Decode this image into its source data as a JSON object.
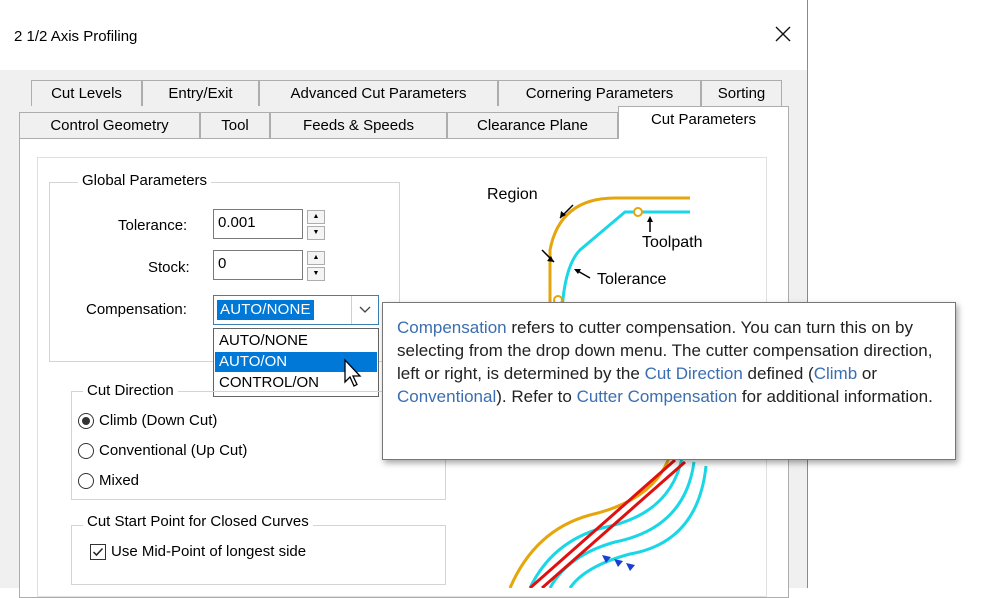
{
  "window": {
    "title": "2 1/2 Axis Profiling"
  },
  "tabs": {
    "row1": [
      "Cut Levels",
      "Entry/Exit",
      "Advanced Cut Parameters",
      "Cornering Parameters",
      "Sorting"
    ],
    "row2": [
      "Control Geometry",
      "Tool",
      "Feeds & Speeds",
      "Clearance Plane",
      "Cut Parameters"
    ],
    "active": "Cut Parameters"
  },
  "global_parameters": {
    "title": "Global Parameters",
    "tolerance_label": "Tolerance:",
    "tolerance_value": "0.001",
    "stock_label": "Stock:",
    "stock_value": "0",
    "compensation_label": "Compensation:",
    "compensation_value": "AUTO/NONE",
    "compensation_options": [
      "AUTO/NONE",
      "AUTO/ON",
      "CONTROL/ON"
    ],
    "highlighted_option": "AUTO/ON"
  },
  "cut_direction": {
    "title": "Cut Direction",
    "options": [
      "Climb (Down Cut)",
      "Conventional (Up Cut)",
      "Mixed"
    ],
    "selected": "Climb (Down Cut)"
  },
  "cut_start": {
    "title": "Cut Start Point for Closed Curves",
    "checkbox_label": "Use Mid-Point of longest side",
    "checked": true
  },
  "diagram": {
    "region_label": "Region",
    "toolpath_label": "Toolpath",
    "tolerance_label": "Tolerance",
    "region_color": "#e6a50a",
    "toolpath_color": "#19d7e6",
    "red_color": "#e01010",
    "blue_color": "#1a3fd0"
  },
  "tooltip": {
    "parts": [
      {
        "text": "Compensation",
        "link": true
      },
      {
        "text": " refers to cutter compensation. You can turn this on by selecting from the drop down menu. The cutter compensation direction, left or right, is determined by the ",
        "link": false
      },
      {
        "text": "Cut Direction",
        "link": true
      },
      {
        "text": " defined (",
        "link": false
      },
      {
        "text": "Climb",
        "link": true
      },
      {
        "text": " or ",
        "link": false
      },
      {
        "text": "Conventional",
        "link": true
      },
      {
        "text": ").  Refer to ",
        "link": false
      },
      {
        "text": "Cutter Compensation",
        "link": true
      },
      {
        "text": " for additional information.",
        "link": false
      }
    ]
  },
  "icons": {
    "close": "close-icon",
    "spin_up": "spin-up-icon",
    "spin_down": "spin-down-icon",
    "dropdown": "chevron-down-icon",
    "cursor": "mouse-pointer-icon"
  }
}
